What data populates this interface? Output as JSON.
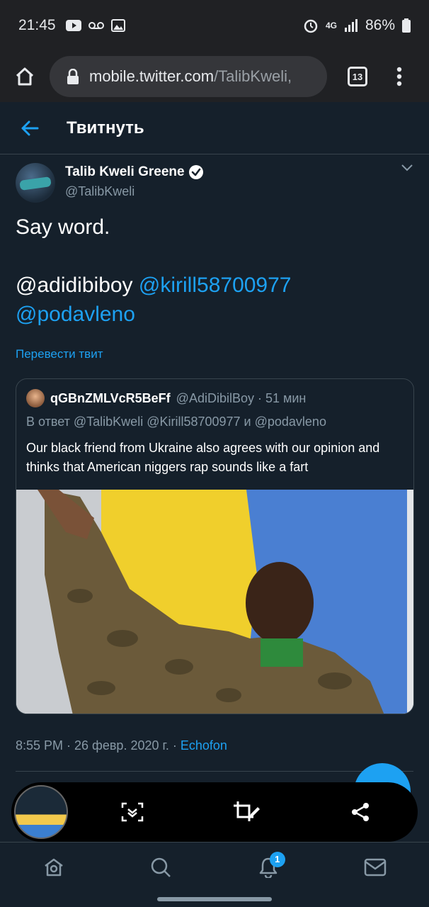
{
  "status_bar": {
    "time": "21:45",
    "network": "4G",
    "battery": "86%"
  },
  "browser": {
    "url_domain": "mobile.twitter.com",
    "url_path": "/TalibKweli,",
    "tab_count": "13"
  },
  "header": {
    "title": "Твитнуть"
  },
  "tweet": {
    "author_name": "Talib Kweli Greene",
    "author_handle": "@TalibKweli",
    "text_line1": "Say word.",
    "mention1": "@adidibiboy",
    "mention2": "@kirill58700977",
    "mention3": "@podavleno",
    "translate": "Перевести твит",
    "timestamp": "8:55 PM · 26 февр. 2020 г. · ",
    "client": "Echofon"
  },
  "quote": {
    "name": "qGBnZMLVcR5BeFf",
    "handle_time": "@AdiDibilBoy · 51 мин",
    "reply_to": "В ответ @TalibKweli @Kirill58700977 и @podavleno",
    "text": "Our black friend from Ukraine also agrees with our opinion and thinks that American niggers rap sounds like a fart"
  },
  "bottom_nav": {
    "notifications_badge": "1"
  },
  "colors": {
    "background": "#15202b",
    "accent": "#1da1f2",
    "muted": "#8899a6",
    "border": "#38444d"
  }
}
